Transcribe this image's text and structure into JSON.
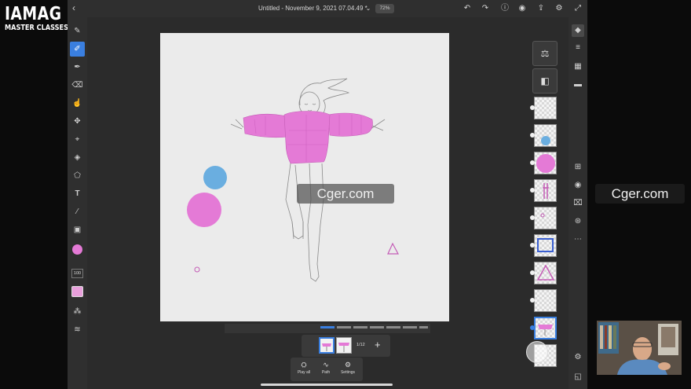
{
  "brand": {
    "line1": "IAMAG",
    "line2": "MASTER CLASSES"
  },
  "app": {
    "document_title": "Untitled - November 9, 2021 07.04.49 *",
    "zoom": "72%"
  },
  "tools": {
    "brush_size": "100",
    "current_color": "#e47ad6"
  },
  "frames": {
    "count": "1/12"
  },
  "animation_panel": {
    "play_all": "Play all",
    "path": "Path",
    "settings": "Settings"
  },
  "watermark": {
    "center": "Cger.com",
    "right": "Cger.com"
  },
  "colors": {
    "accent": "#3a7fe0",
    "jacket_pink": "#e47ad6",
    "circle_blue": "#6aaee0",
    "circle_pink": "#e47ad6",
    "canvas": "#ebebeb"
  }
}
